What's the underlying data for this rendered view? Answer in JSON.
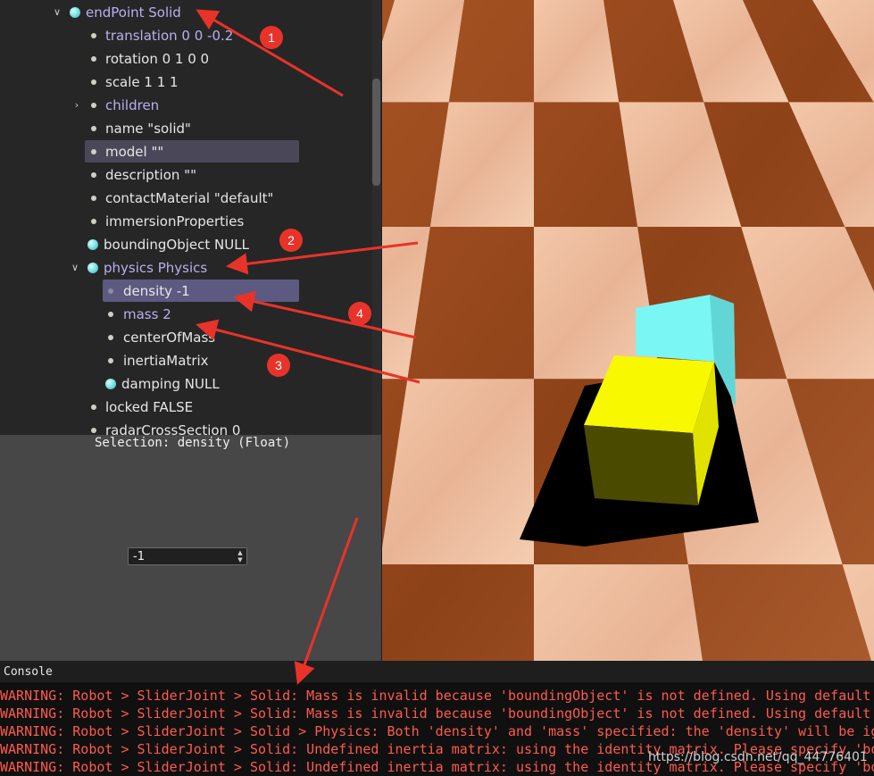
{
  "tree": {
    "items": [
      {
        "label": "endPoint Solid",
        "kind": "node",
        "chevron": "down"
      },
      {
        "label": "translation 0 0 -0.2",
        "kind": "changed"
      },
      {
        "label": "rotation 0 1 0 0",
        "kind": "field"
      },
      {
        "label": "scale 1 1 1",
        "kind": "field"
      },
      {
        "label": "children",
        "kind": "changed",
        "chevron": "right"
      },
      {
        "label": "name \"solid\"",
        "kind": "field"
      },
      {
        "label": "model \"\"",
        "kind": "field",
        "highlighted": true
      },
      {
        "label": "description \"\"",
        "kind": "field"
      },
      {
        "label": "contactMaterial \"default\"",
        "kind": "field"
      },
      {
        "label": "immersionProperties",
        "kind": "field"
      },
      {
        "label": "boundingObject NULL",
        "kind": "sfnode"
      },
      {
        "label": "physics Physics",
        "kind": "node",
        "chevron": "down"
      },
      {
        "label": "density -1",
        "kind": "field",
        "selected": true
      },
      {
        "label": "mass 2",
        "kind": "changed"
      },
      {
        "label": "centerOfMass",
        "kind": "field"
      },
      {
        "label": "inertiaMatrix",
        "kind": "field"
      },
      {
        "label": "damping NULL",
        "kind": "sfnode"
      },
      {
        "label": "locked FALSE",
        "kind": "field"
      },
      {
        "label": "radarCrossSection 0",
        "kind": "field"
      }
    ]
  },
  "editor": {
    "selection_caption": "Selection: density (Float)",
    "value": "-1"
  },
  "console": {
    "title": "Console",
    "lines": [
      "WARNING: Robot > SliderJoint > Solid: Mass is invalid because 'boundingObject' is not defined. Using default",
      "WARNING: Robot > SliderJoint > Solid: Mass is invalid because 'boundingObject' is not defined. Using default",
      "WARNING: Robot > SliderJoint > Solid > Physics: Both 'density' and 'mass' specified: the 'density' will be ig",
      "WARNING: Robot > SliderJoint > Solid: Undefined inertia matrix: using the identity matrix. Please specify 'bo",
      "WARNING: Robot > SliderJoint > Solid: Undefined inertia matrix: using the identity matrix. Please specify 'bo"
    ]
  },
  "watermark": "https://blog.csdn.net/qq_44776401",
  "annotations": {
    "badges": [
      "1",
      "2",
      "3",
      "4"
    ],
    "color": "#e8332a"
  },
  "colors": {
    "node_label": "#b8b0f0",
    "warning_text": "#ff5a4e",
    "cube_cyan": "#7af6f4",
    "cube_yellow": "#f8f800"
  },
  "icons": {
    "sfnode": "cyan-ball-icon",
    "field": "bullet-icon",
    "expand": "chevron-icon"
  }
}
